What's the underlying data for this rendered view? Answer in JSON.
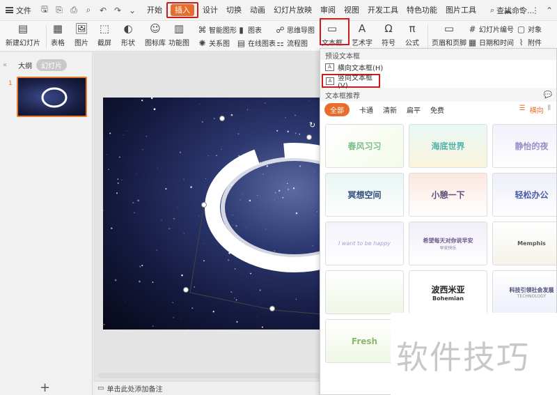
{
  "menu": {
    "file_label": "文件",
    "tabs": [
      "开始",
      "插入",
      "设计",
      "切换",
      "动画",
      "幻灯片放映",
      "审阅",
      "视图",
      "开发工具",
      "特色功能",
      "图片工具"
    ],
    "active_tab": "插入",
    "search_label": "查找命令..."
  },
  "ribbon": {
    "new_slide": "新建幻灯片",
    "table": "表格",
    "picture": "图片",
    "screenshot": "截屏",
    "shape": "形状",
    "icon_lib": "图标库",
    "func_chart": "功能图",
    "smart_shape": "智能图形",
    "chart": "图表",
    "relation": "关系图",
    "online_chart": "在线图表",
    "mindmap": "思维导图",
    "flowchart": "流程图",
    "textbox": "文本框",
    "wordart": "艺术字",
    "symbol": "符号",
    "formula": "公式",
    "header_footer": "页眉和页脚",
    "slide_number": "幻灯片编号",
    "object": "对象",
    "datetime": "日期和时间",
    "attachment": "附件"
  },
  "leftpanel": {
    "outline_tab": "大纲",
    "slides_tab": "幻灯片",
    "slide_number": "1"
  },
  "notes": {
    "placeholder": "单击此处添加备注"
  },
  "dropdown": {
    "preset_header": "预设文本框",
    "horizontal": "横向文本框(H)",
    "vertical": "竖向文本框(V)",
    "recommend_header": "文本框推荐",
    "filters": [
      "全部",
      "卡通",
      "清新",
      "扁平",
      "免费"
    ],
    "orient_horizontal": "横向",
    "cards": [
      {
        "title": "春风习习",
        "color": "#7bbf8a"
      },
      {
        "title": "海底世界",
        "color": "#4fb3a9"
      },
      {
        "title": "静怡的夜",
        "color": "#9a8ec8"
      },
      {
        "title": "冥想空间",
        "color": "#2d4b7a"
      },
      {
        "title": "小憩一下",
        "color": "#5b4d7a"
      },
      {
        "title": "轻松办公",
        "color": "#4a5ba8"
      },
      {
        "title": "I want to be happy",
        "color": "#a89ed0"
      },
      {
        "title": "希望每天对你说早安",
        "color": "#6a5a8a"
      },
      {
        "title": "Memphis",
        "color": "#555555"
      },
      {
        "title": "",
        "color": "#8bb86a"
      },
      {
        "title": "波西米亚",
        "color": "#222222"
      },
      {
        "title": "科技引领社会发展",
        "color": "#4a4a7a"
      },
      {
        "title": "Fresh",
        "color": "#8bb86a"
      }
    ],
    "card_sub_bohemian": "Bohemian",
    "card_sub_tech": "TECHNOLOGY",
    "card_sub_morning": "早安快乐"
  },
  "watermark": "软件技巧"
}
